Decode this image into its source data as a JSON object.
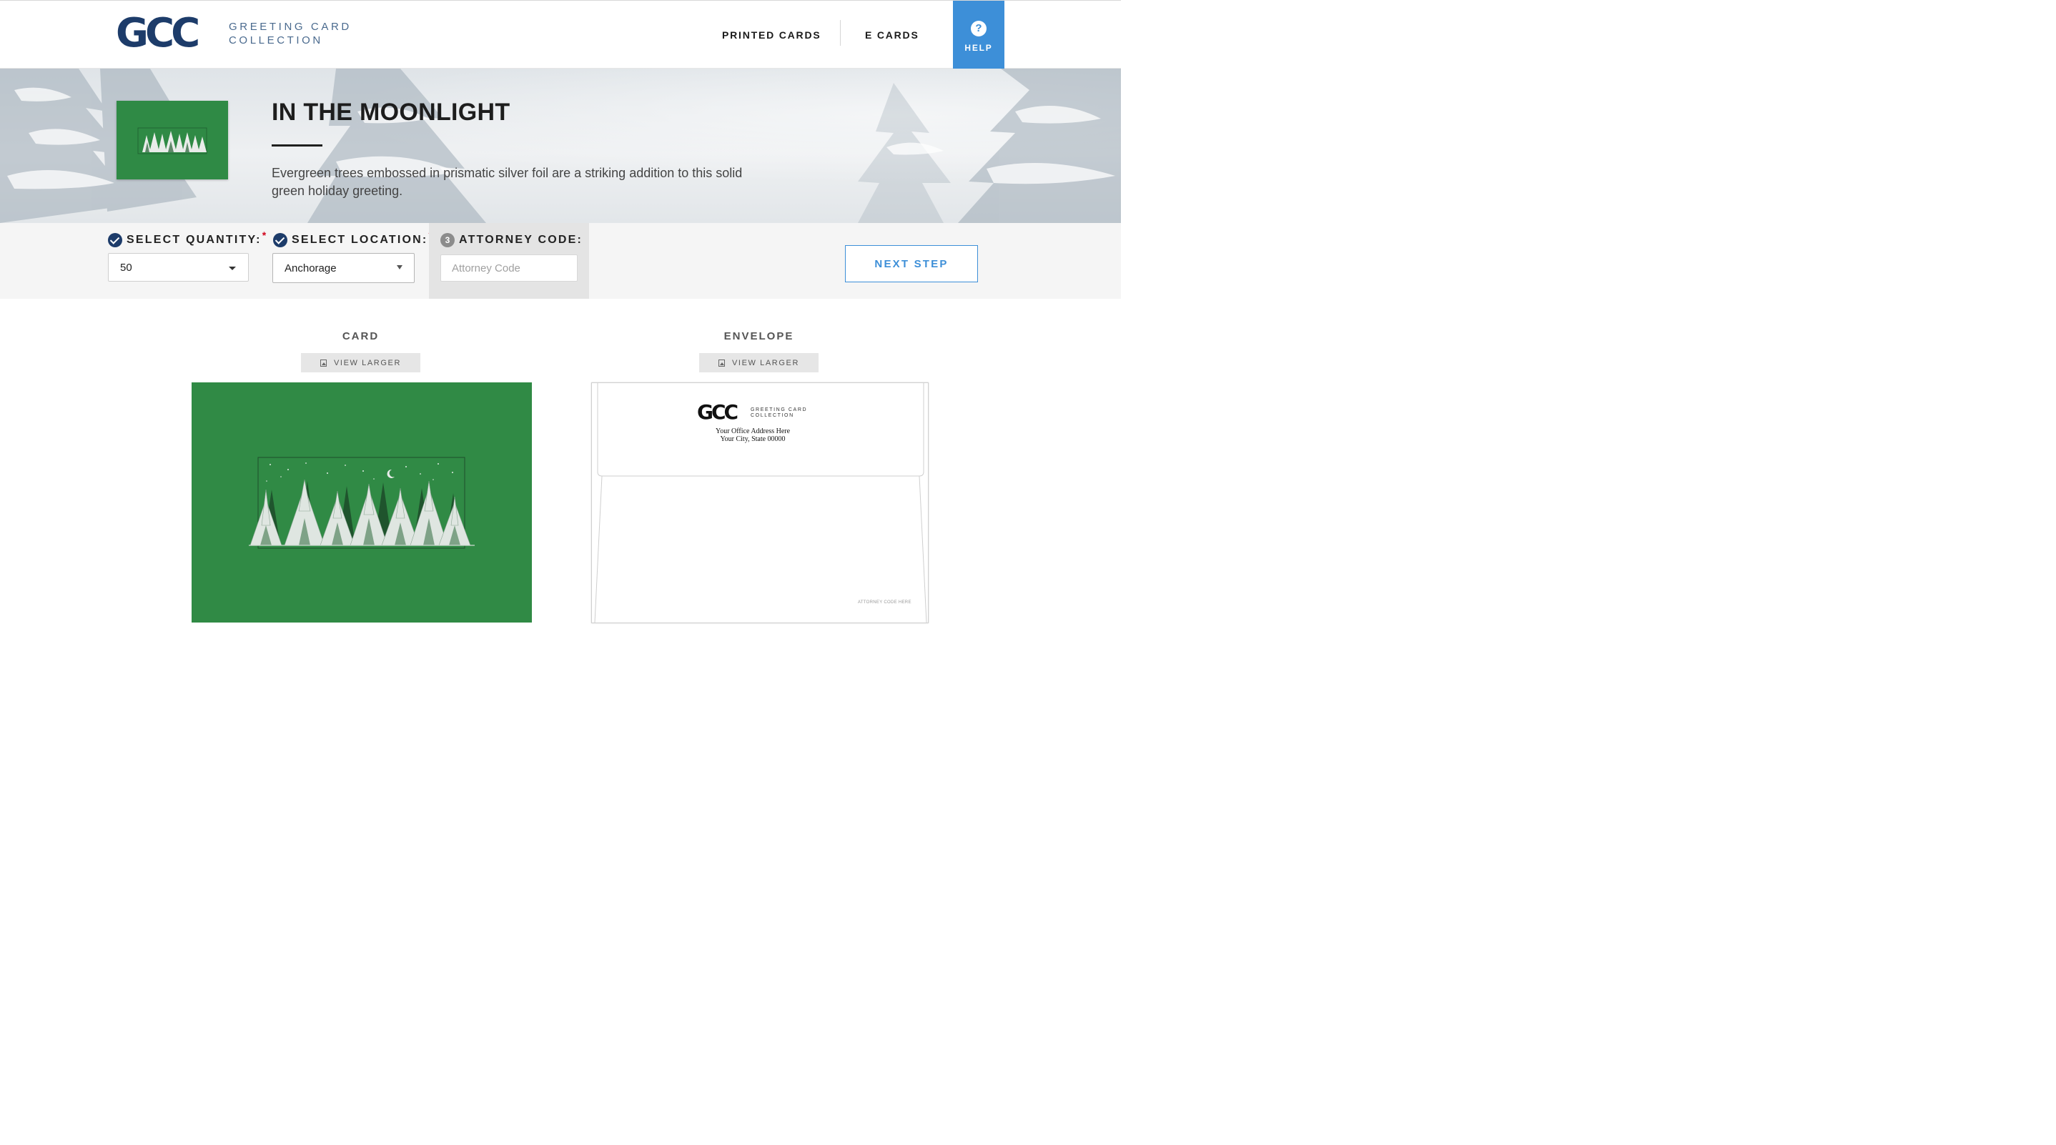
{
  "header": {
    "logo_mark": "GCC",
    "logo_line1": "GREETING CARD",
    "logo_line2": "COLLECTION",
    "nav": {
      "printed_cards": "PRINTED CARDS",
      "e_cards": "E CARDS",
      "help": "HELP"
    },
    "accent_color": "#3d8fd8",
    "brand_color": "#1d3c6a"
  },
  "hero": {
    "title": "IN THE MOONLIGHT",
    "description": "Evergreen trees embossed in prismatic silver foil are a striking addition to this solid green holiday greeting.",
    "card_color": "#2f8a45"
  },
  "options": {
    "quantity": {
      "label": "SELECT QUANTITY:",
      "required_mark": "*",
      "value": "50",
      "options": [
        "50"
      ]
    },
    "location": {
      "label": "SELECT LOCATION:",
      "required_mark": "*",
      "value": "Anchorage",
      "options": [
        "Anchorage"
      ]
    },
    "attorney": {
      "step": "3",
      "label": "ATTORNEY CODE:",
      "placeholder": "Attorney Code",
      "value": ""
    },
    "next_step": "NEXT STEP"
  },
  "previews": {
    "card": {
      "title": "CARD",
      "view_larger": "VIEW LARGER"
    },
    "envelope": {
      "title": "ENVELOPE",
      "view_larger": "VIEW LARGER",
      "logo_mark": "GCC",
      "logo_line1": "GREETING CARD",
      "logo_line2": "COLLECTION",
      "address_line1": "Your Office Address Here",
      "address_line2": "Your City, State 00000",
      "attorney_code": "ATTORNEY CODE HERE"
    }
  }
}
